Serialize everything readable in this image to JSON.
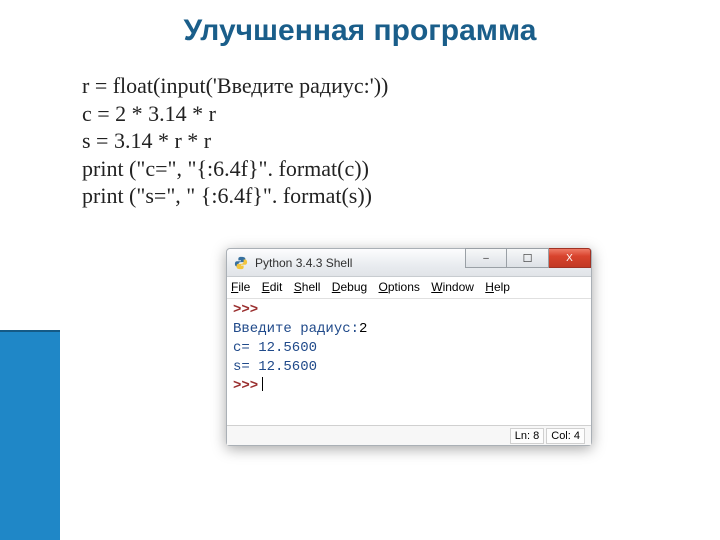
{
  "slide": {
    "title": "Улучшенная программа"
  },
  "code": {
    "lines": [
      "r = float(input('Введите радиус:'))",
      "c  = 2 * 3.14 * r",
      "s = 3.14 * r * r",
      "print (\"c=\", \"{:6.4f}\". format(c))",
      "print (\"s=\", \" {:6.4f}\". format(s))"
    ]
  },
  "window": {
    "title": "Python 3.4.3 Shell",
    "menu": {
      "file": {
        "accel": "F",
        "rest": "ile"
      },
      "edit": {
        "accel": "E",
        "rest": "dit"
      },
      "shell": {
        "accel": "S",
        "rest": "hell"
      },
      "debug": {
        "accel": "D",
        "rest": "ebug"
      },
      "options": {
        "accel": "O",
        "rest": "ptions"
      },
      "window": {
        "accel": "W",
        "rest": "indow"
      },
      "help": {
        "accel": "H",
        "rest": "elp"
      }
    },
    "console": {
      "prompt": ">>>",
      "input_line_prefix": "Введите радиус:",
      "input_value": "2",
      "out_c": "c= 12.5600",
      "out_s": "s= 12.5600"
    },
    "status": {
      "ln": "Ln: 8",
      "col": "Col: 4"
    },
    "buttons": {
      "minimize": "–",
      "maximize": "☐",
      "close": "X"
    }
  }
}
